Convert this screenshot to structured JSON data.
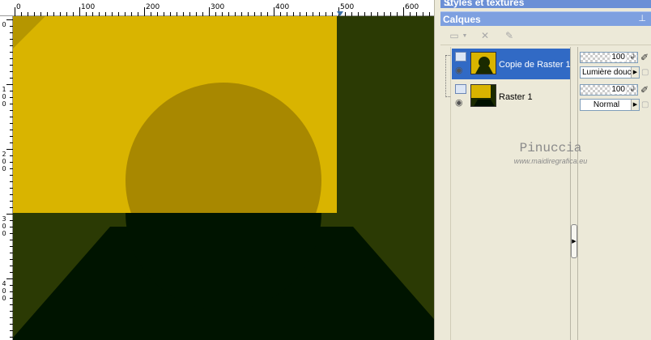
{
  "top_panel": {
    "title": "Styles et textures"
  },
  "layers_panel": {
    "title": "Calques",
    "layers": [
      {
        "name": "Copie de Raster 1",
        "opacity": "100",
        "blend_mode": "Lumière douce"
      },
      {
        "name": "Raster 1",
        "opacity": "100",
        "blend_mode": "Normal"
      }
    ]
  },
  "ruler": {
    "h_labels": [
      "0",
      "100",
      "200",
      "300",
      "400",
      "500",
      "600"
    ],
    "v_labels": [
      "0",
      "100",
      "200",
      "300",
      "400"
    ]
  },
  "watermark": {
    "line1": "Pinuccia",
    "line2": "www.maidiregrafica.eu"
  },
  "colors": {
    "canvas_dark": "#2b3a04",
    "canvas_black": "#001400",
    "yellow": "#d9b400",
    "circle_ochre": "#a88800",
    "selection_blue": "#316ac5",
    "header_blue": "#7ea0e0"
  },
  "icons": {
    "layer_type": "raster-layer-icon",
    "visibility": "eye-icon",
    "pin": "pin-icon",
    "brush": "brush-icon",
    "lock": "lock-icon"
  }
}
